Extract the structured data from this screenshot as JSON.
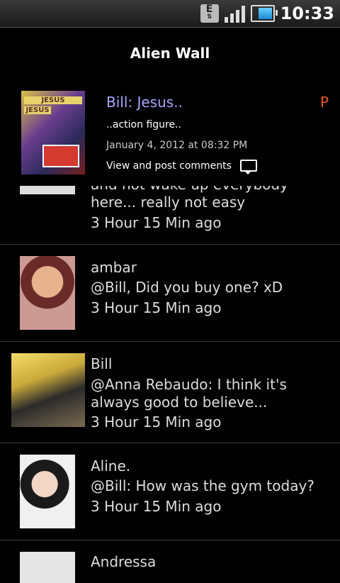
{
  "status": {
    "time": "10:33",
    "network": "E"
  },
  "screen_title": "Alien Wall",
  "post": {
    "title": "Bill: Jesus..",
    "flag": "P",
    "description": "..action figure..",
    "date": "January 4, 2012 at 08:32 PM",
    "comments_link": "View and post comments",
    "thumb_text_1": "JESUS",
    "thumb_text_2": "JESUS"
  },
  "comments": [
    {
      "name": "",
      "message": "and not wake up everybody here... really not easy",
      "time": "3 Hour 15 Min ago"
    },
    {
      "name": "ambar",
      "message": "@Bill, Did you buy one? xD",
      "time": "3 Hour 15 Min ago"
    },
    {
      "name": "Bill",
      "message": "@Anna Rebaudo: I think it's always good to believe...",
      "time": "3 Hour 15 Min ago"
    },
    {
      "name": "Aline.",
      "message": "@Bill: How was the gym today?",
      "time": "3 Hour 15 Min ago"
    },
    {
      "name": "Andressa",
      "message": "",
      "time": ""
    }
  ]
}
